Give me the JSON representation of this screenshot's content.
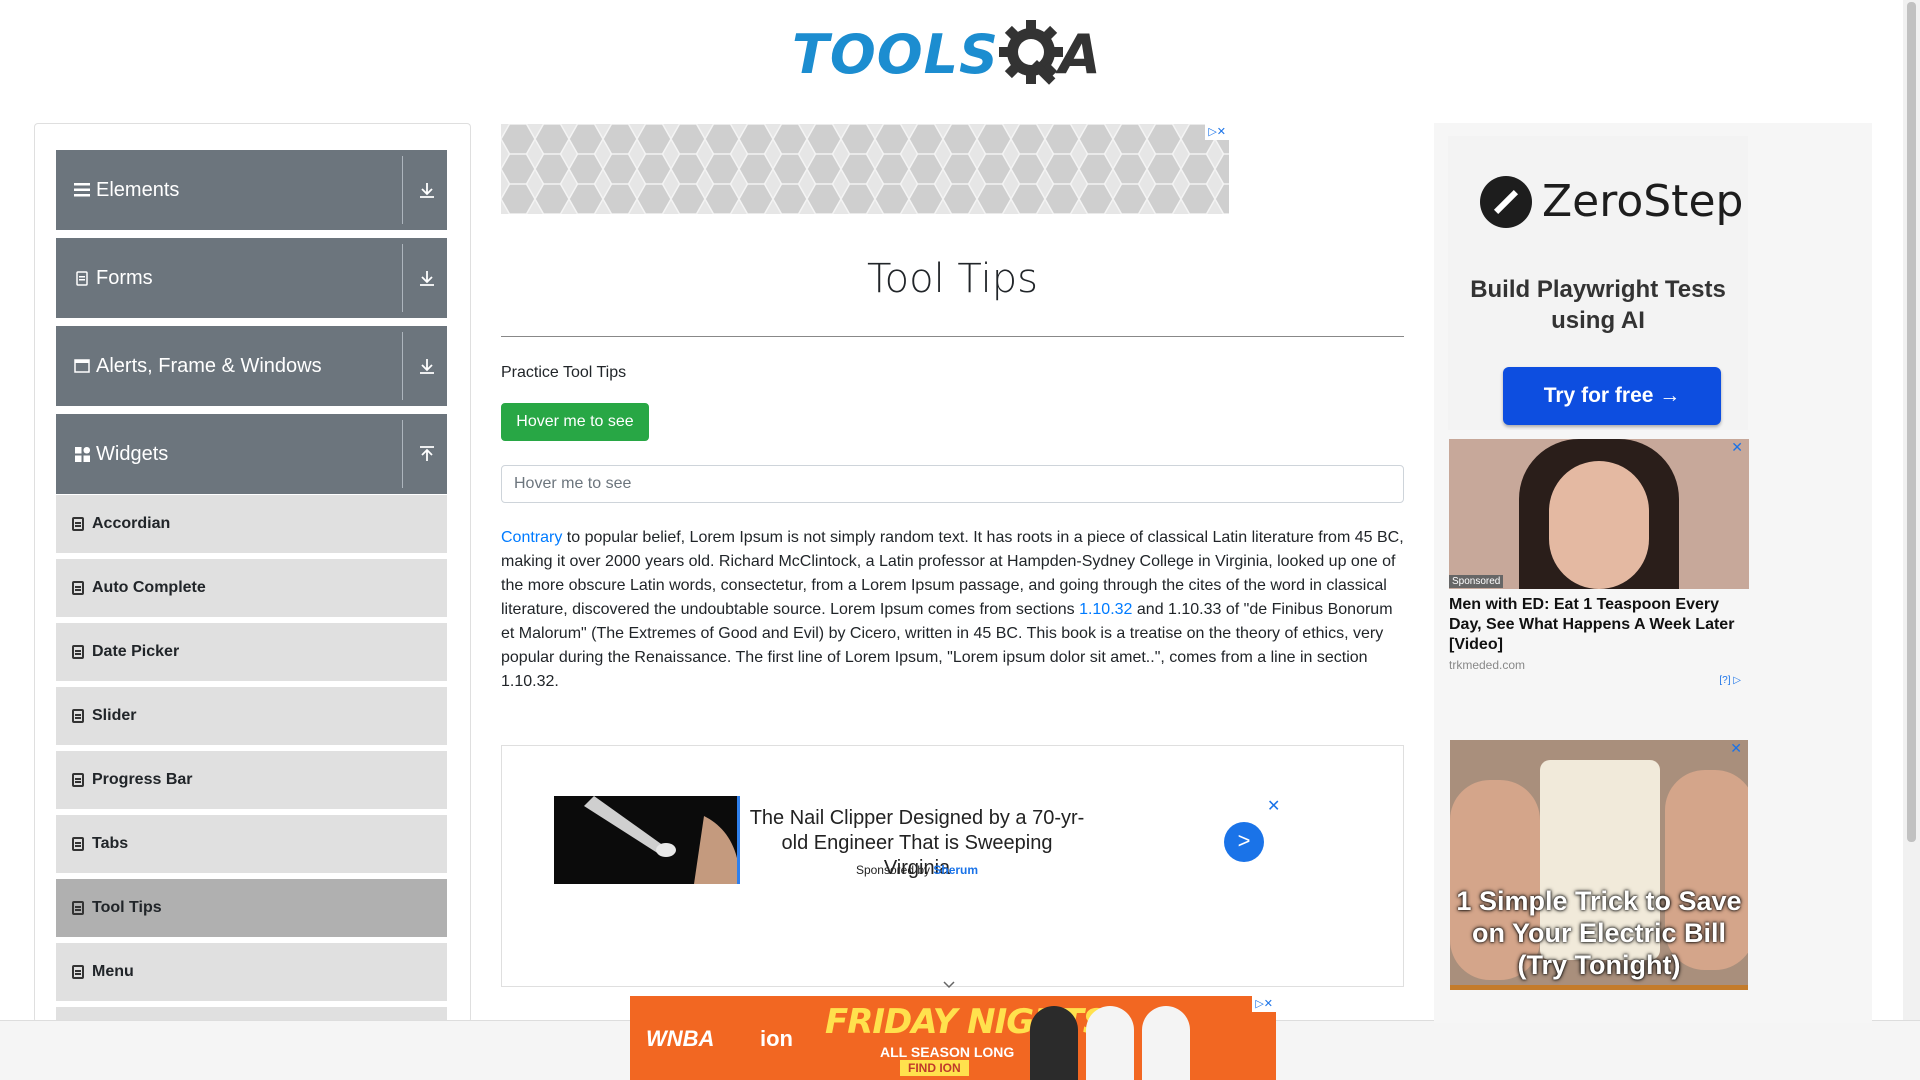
{
  "header": {
    "logo_text_left": "TOOLS",
    "logo_text_right": "A"
  },
  "sidebar": {
    "groups": [
      {
        "label": "Elements",
        "icon": "hamburger-icon",
        "arrow": "download-arrow-icon"
      },
      {
        "label": "Forms",
        "icon": "form-icon",
        "arrow": "download-arrow-icon"
      },
      {
        "label": "Alerts, Frame & Windows",
        "icon": "window-icon",
        "arrow": "download-arrow-icon"
      },
      {
        "label": "Widgets",
        "icon": "widgets-icon",
        "arrow": "upload-arrow-icon"
      }
    ],
    "items": [
      {
        "label": "Accordian"
      },
      {
        "label": "Auto Complete"
      },
      {
        "label": "Date Picker"
      },
      {
        "label": "Slider"
      },
      {
        "label": "Progress Bar"
      },
      {
        "label": "Tabs"
      },
      {
        "label": "Tool Tips",
        "active": true
      },
      {
        "label": "Menu"
      }
    ]
  },
  "main": {
    "title": "Tool Tips",
    "practice_label": "Practice Tool Tips",
    "hover_button": "Hover me to see",
    "hover_input_placeholder": "Hover me to see",
    "paragraph": {
      "link1": "Contrary",
      "text1": " to popular belief, Lorem Ipsum is not simply random text. It has roots in a piece of classical Latin literature from 45 BC, making it over 2000 years old. Richard McClintock, a Latin professor at Hampden-Sydney College in Virginia, looked up one of the more obscure Latin words, consectetur, from a Lorem Ipsum passage, and going through the cites of the word in classical literature, discovered the undoubtable source. Lorem Ipsum comes from sections ",
      "link2": "1.10.32",
      "text2": " and 1.10.33 of \"de Finibus Bonorum et Malorum\" (The Extremes of Good and Evil) by Cicero, written in 45 BC. This book is a treatise on the theory of ethics, very popular during the Renaissance. The first line of Lorem Ipsum, \"Lorem ipsum dolor sit amet..\", comes from a line in section 1.10.32."
    }
  },
  "native_ad": {
    "headline": "The Nail Clipper Designed by a 70-yr-old Engineer That is Sweeping Virginia",
    "sponsored_by": "Sponsored by",
    "brand": "Sherum",
    "go": ">",
    "close": "✕"
  },
  "bottom_ad": {
    "league": "WNBA",
    "network": "ion",
    "headline": "FRIDAY NIGHTS",
    "sub": "ALL SEASON LONG",
    "cta": "FIND ION"
  },
  "right_ads": {
    "zerostep": {
      "name": "ZeroStep",
      "tagline": "Build Playwright Tests using AI",
      "cta": "Try for free →"
    },
    "ad2": {
      "sponsored": "Sponsored",
      "headline": "Men with ED: Eat 1 Teaspoon Every Day, See What Happens A Week Later [Video]",
      "domain": "trkmeded.com",
      "info": "[?]"
    },
    "ad3": {
      "headline": "1 Simple Trick to Save on Your Electric Bill (Try Tonight)"
    }
  }
}
